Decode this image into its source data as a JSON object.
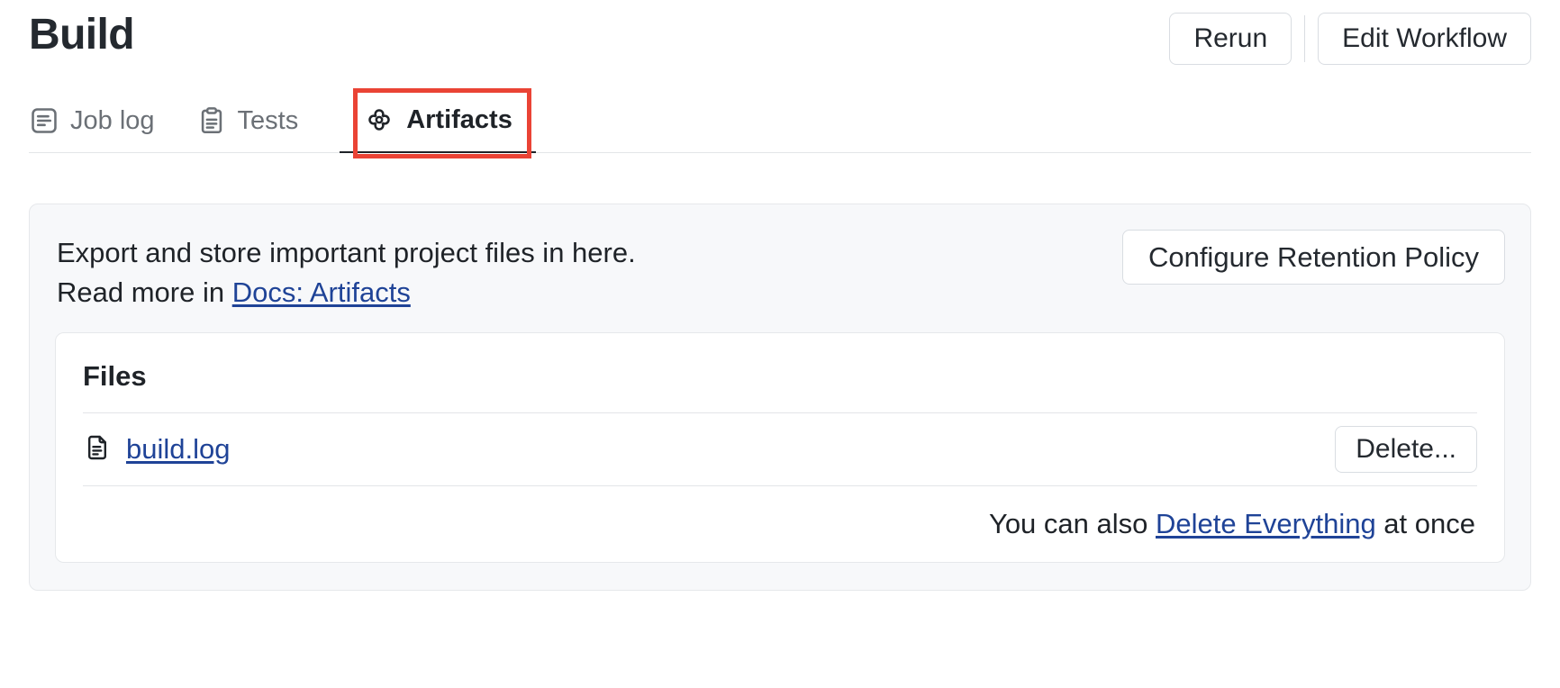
{
  "header": {
    "title": "Build",
    "actions": [
      {
        "label": "Rerun",
        "name": "rerun-button"
      },
      {
        "label": "Edit Workflow",
        "name": "edit-workflow-button"
      }
    ]
  },
  "tabs": [
    {
      "label": "Job log",
      "icon": "job-log-icon",
      "active": false
    },
    {
      "label": "Tests",
      "icon": "clipboard-icon",
      "active": false
    },
    {
      "label": "Artifacts",
      "icon": "artifacts-icon",
      "active": true
    }
  ],
  "highlight": {
    "color": "#ea4335",
    "target": "Artifacts"
  },
  "artifacts": {
    "description_line1": "Export and store important project files in here.",
    "description_line2_prefix": "Read more in ",
    "docs_link": "Docs: Artifacts",
    "retention_button": "Configure Retention Policy",
    "files": {
      "title": "Files",
      "rows": [
        {
          "icon": "file-icon",
          "name": "build.log",
          "action": "Delete..."
        }
      ],
      "footer_prefix": "You can also ",
      "footer_link": "Delete Everything",
      "footer_suffix": " at once"
    }
  },
  "colors": {
    "link": "#1f4397",
    "highlight": "#ea4335",
    "panel_bg": "#f7f8fa",
    "text": "#1f2328",
    "muted": "#6b7076"
  }
}
